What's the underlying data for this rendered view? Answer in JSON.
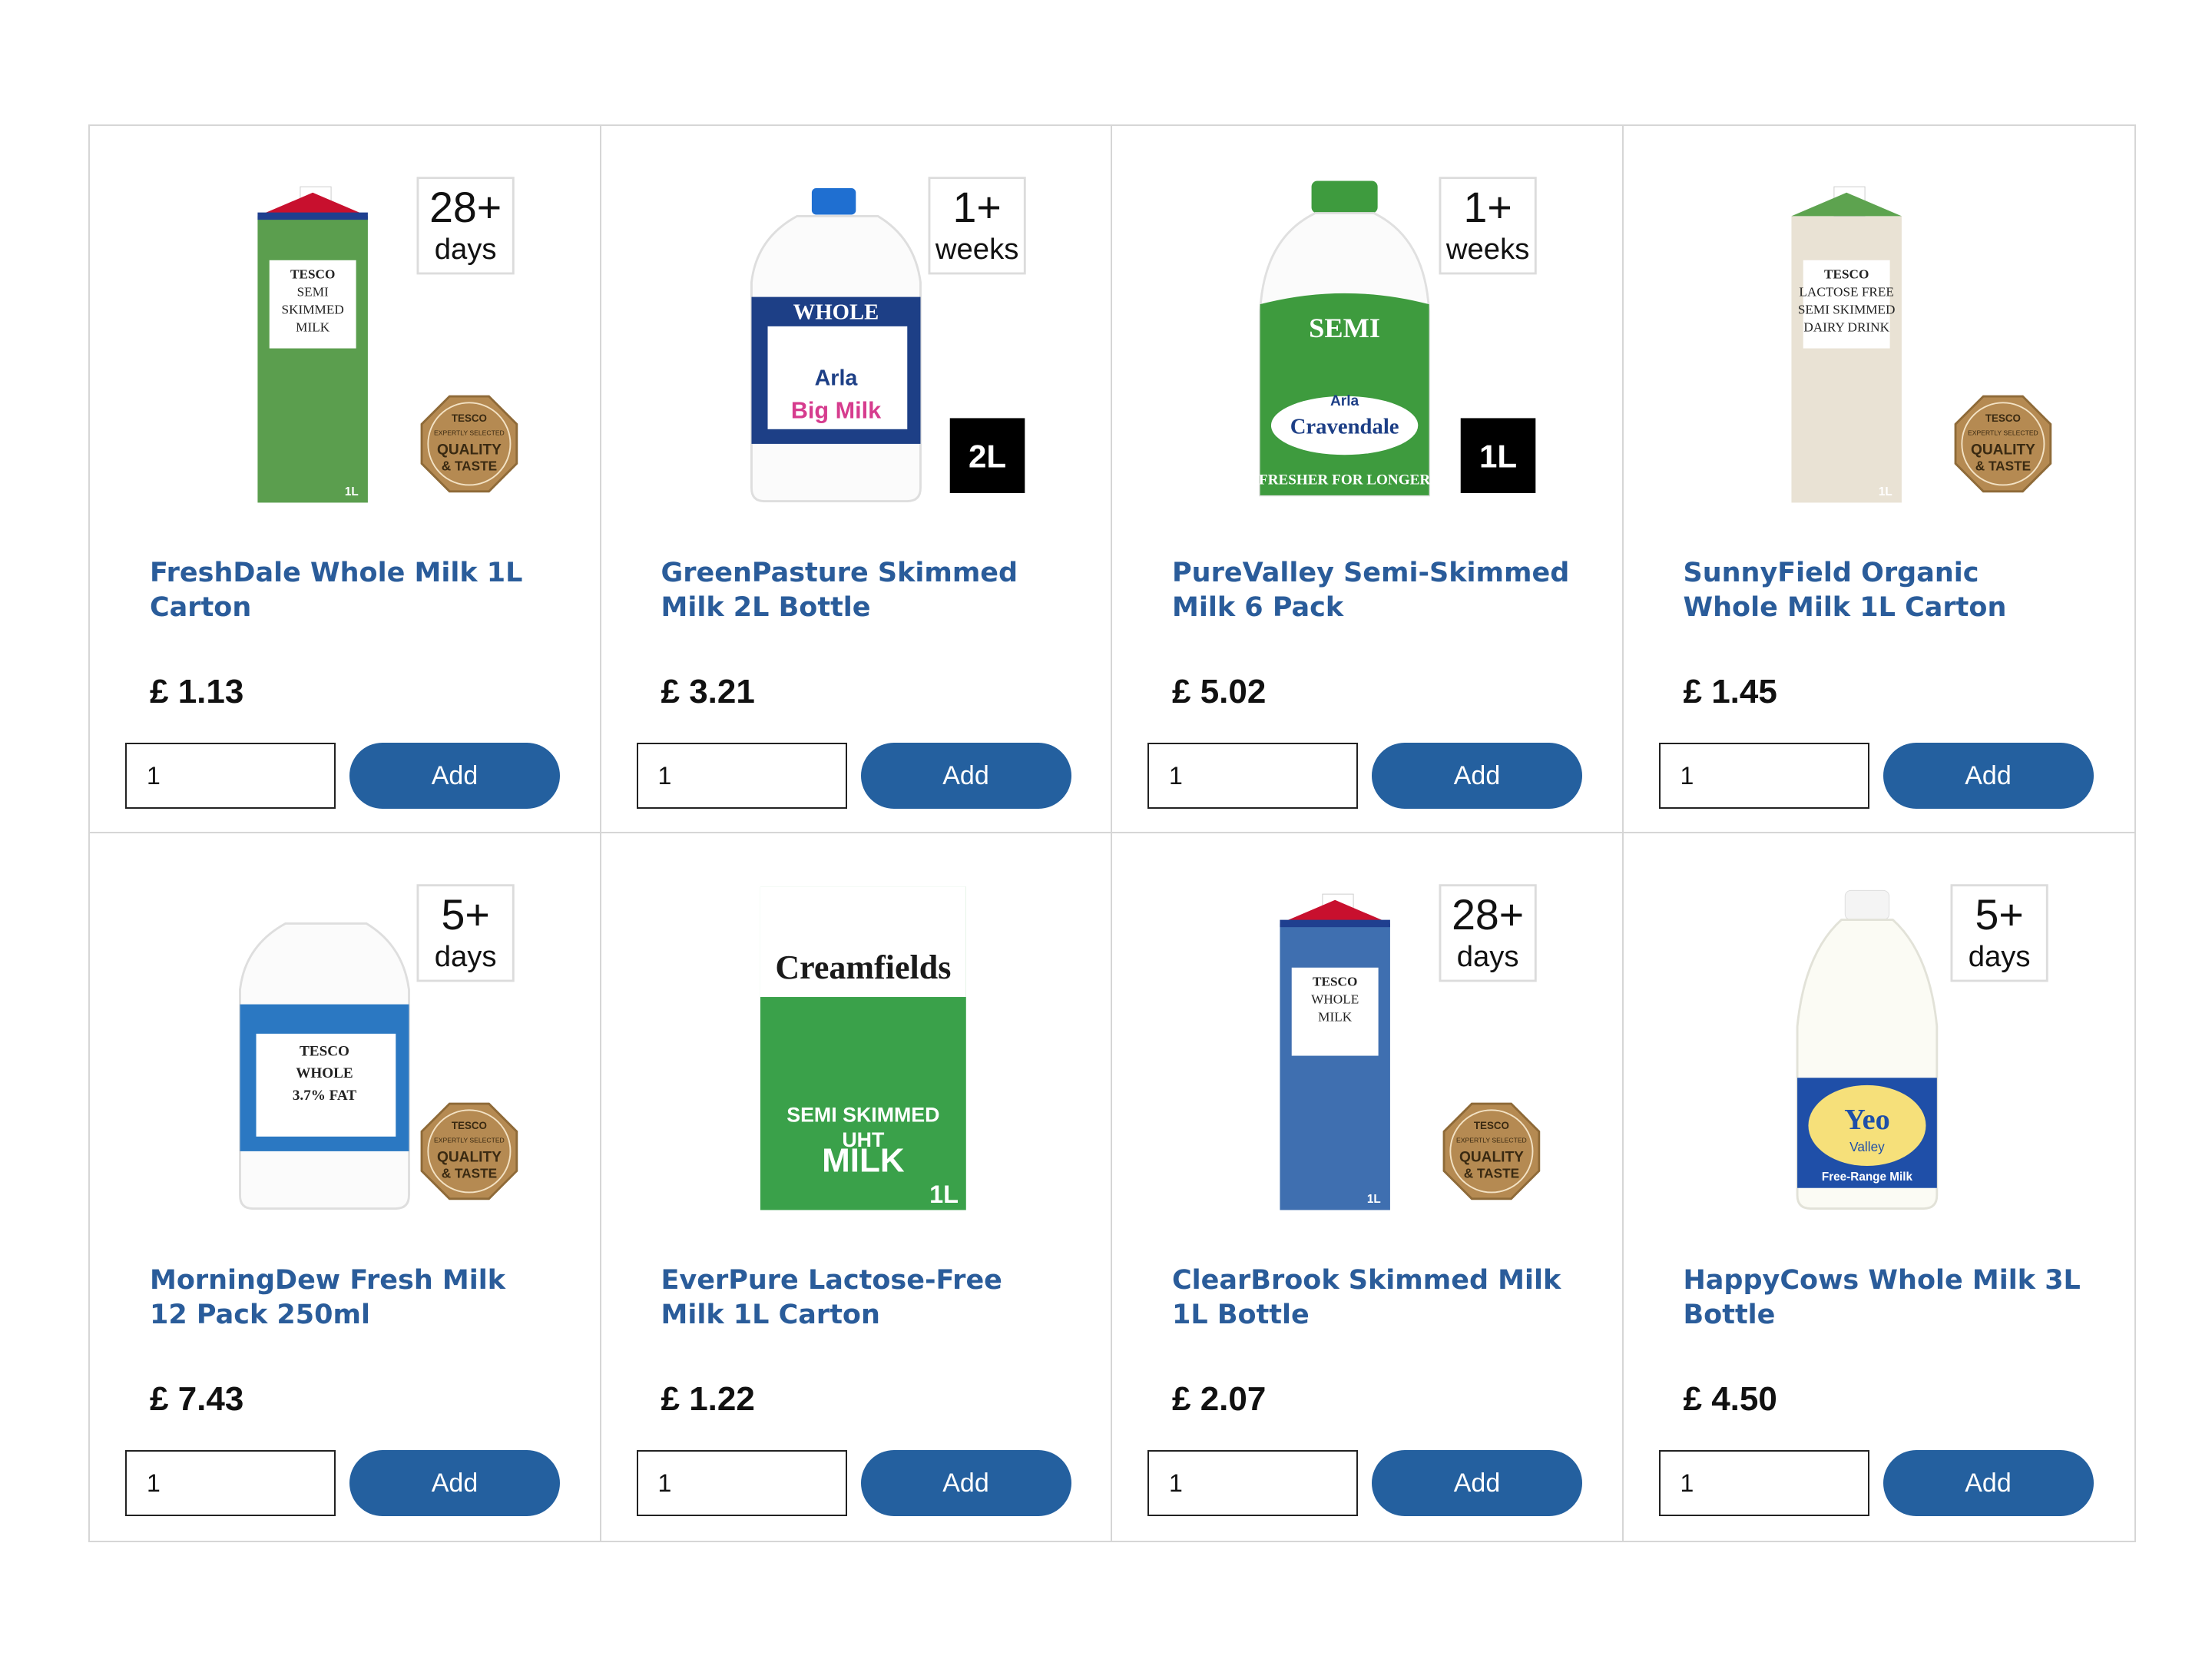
{
  "products": [
    {
      "name": "FreshDale Whole Milk 1L Carton",
      "price": "£ 1.13",
      "qty": "1",
      "add_label": "Add",
      "image": {
        "kind": "carton",
        "body": "#5b9e4e",
        "top_flag": true,
        "label": [
          "TESCO",
          "SEMI",
          "SKIMMED",
          "MILK"
        ],
        "badge_top": "28+",
        "badge_bottom": "days",
        "size_tag": "",
        "quality_seal": true,
        "seal_text": [
          "TESCO",
          "EXPERTLY SELECTED",
          "QUALITY",
          "& TASTE"
        ],
        "volume": "1L"
      }
    },
    {
      "name": "GreenPasture Skimmed Milk 2L Bottle",
      "price": "£ 3.21",
      "qty": "1",
      "add_label": "Add",
      "image": {
        "kind": "jug",
        "cap": "#1f6fd1",
        "label": [
          "WHOLE"
        ],
        "brand": "Arla",
        "sub": "Big Milk",
        "badge_top": "1+",
        "badge_bottom": "weeks",
        "size_tag": "2L",
        "quality_seal": false
      }
    },
    {
      "name": "PureValley Semi-Skimmed Milk 6 Pack",
      "price": "£ 5.02",
      "qty": "1",
      "add_label": "Add",
      "image": {
        "kind": "bottle",
        "cap": "#3e9b3e",
        "label": [
          "SEMI"
        ],
        "brand": "Arla",
        "sub": "Cravendale",
        "tagline": "FRESHER FOR LONGER",
        "badge_top": "1+",
        "badge_bottom": "weeks",
        "size_tag": "1L",
        "quality_seal": false
      }
    },
    {
      "name": "SunnyField Organic Whole Milk 1L Carton",
      "price": "£ 1.45",
      "qty": "1",
      "add_label": "Add",
      "image": {
        "kind": "carton",
        "body": "#e9e2d4",
        "top_flag": false,
        "label": [
          "TESCO",
          "LACTOSE FREE",
          "SEMI SKIMMED",
          "DAIRY DRINK"
        ],
        "badge_top": "",
        "badge_bottom": "",
        "size_tag": "",
        "quality_seal": true,
        "seal_text": [
          "TESCO",
          "EXPERTLY SELECTED",
          "QUALITY",
          "& TASTE"
        ],
        "volume": "1L"
      }
    },
    {
      "name": "MorningDew Fresh Milk 12 Pack 250ml",
      "price": "£ 7.43",
      "qty": "1",
      "add_label": "Add",
      "image": {
        "kind": "jug",
        "cap": "#ffffff",
        "label": [
          "TESCO",
          "WHOLE",
          "3.7% FAT"
        ],
        "brand": "",
        "sub": "",
        "badge_top": "5+",
        "badge_bottom": "days",
        "size_tag": "",
        "quality_seal": true,
        "seal_text": [
          "TESCO",
          "EXPERTLY SELECTED",
          "QUALITY",
          "& TASTE"
        ]
      }
    },
    {
      "name": "EverPure Lactose-Free Milk 1L Carton",
      "price": "£ 1.22",
      "qty": "1",
      "add_label": "Add",
      "image": {
        "kind": "uht",
        "body": "#3aa14a",
        "brand": "Creamfields",
        "label": [
          "SEMI SKIMMED",
          "UHT",
          "MILK"
        ],
        "volume": "1L",
        "badge_top": "",
        "badge_bottom": "",
        "size_tag": "",
        "quality_seal": false
      }
    },
    {
      "name": "ClearBrook Skimmed Milk 1L Bottle",
      "price": "£ 2.07",
      "qty": "1",
      "add_label": "Add",
      "image": {
        "kind": "carton",
        "body": "#3f6fb0",
        "top_flag": true,
        "label": [
          "TESCO",
          "WHOLE",
          "MILK"
        ],
        "badge_top": "28+",
        "badge_bottom": "days",
        "size_tag": "",
        "quality_seal": true,
        "seal_text": [
          "TESCO",
          "EXPERTLY SELECTED",
          "QUALITY",
          "& TASTE"
        ],
        "volume": "1L"
      }
    },
    {
      "name": "HappyCows Whole Milk 3L Bottle",
      "price": "£ 4.50",
      "qty": "1",
      "add_label": "Add",
      "image": {
        "kind": "yeo",
        "cap": "#ffffff",
        "brand": "Yeo",
        "sub": "Valley",
        "tagline": "Free-Range Milk",
        "badge_top": "5+",
        "badge_bottom": "days",
        "size_tag": "",
        "quality_seal": false
      }
    }
  ],
  "colors": {
    "title": "#2a5c9a",
    "button": "#24609f",
    "grid_line": "#d6d6d6"
  }
}
